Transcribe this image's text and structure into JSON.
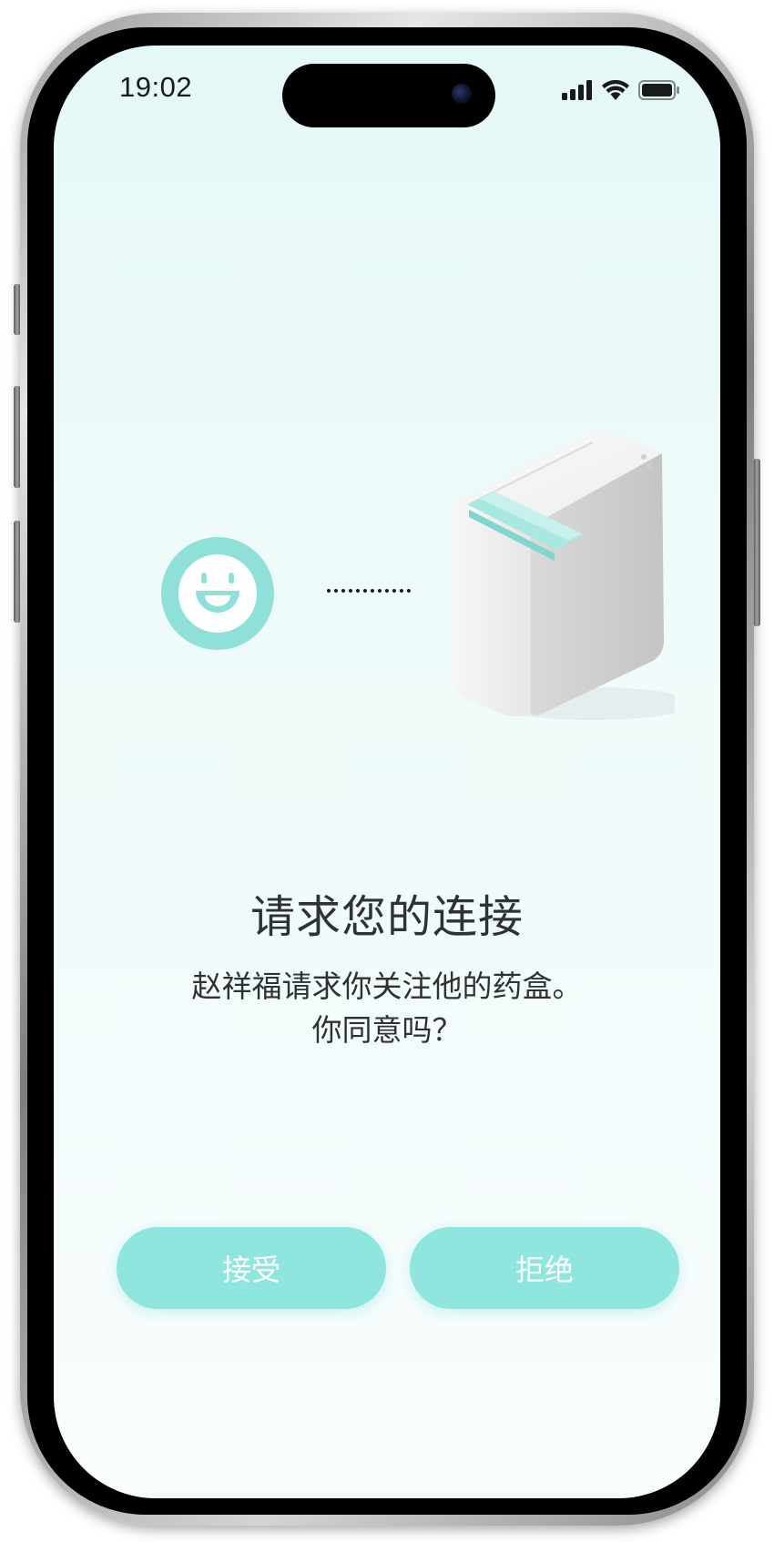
{
  "status_bar": {
    "time": "19:02",
    "icons": [
      "cellular-signal-icon",
      "wifi-icon",
      "battery-icon"
    ]
  },
  "illustration": {
    "avatar_icon": "smiley-face-icon",
    "connector": "dotted-line",
    "device": "pill-box-device-image"
  },
  "main": {
    "title": "请求您的连接",
    "message_line1": "赵祥福请求你关注他的药盒。",
    "message_line2": "你同意吗？"
  },
  "actions": {
    "accept_label": "接受",
    "reject_label": "拒绝"
  },
  "colors": {
    "accent": "#8ee6de",
    "avatar_ring": "#8ee0d9",
    "text": "#2f3233",
    "background": "#eefbfa"
  }
}
